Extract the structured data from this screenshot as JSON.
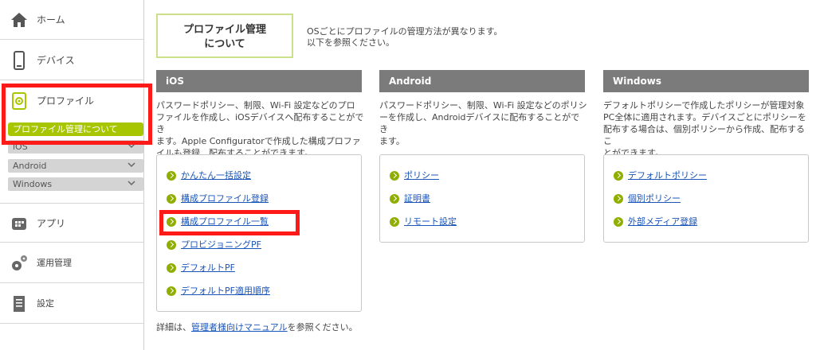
{
  "sidebar": {
    "items": [
      {
        "label": "ホーム",
        "icon": "home-icon"
      },
      {
        "label": "デバイス",
        "icon": "device-icon"
      },
      {
        "label": "プロファイル",
        "icon": "profile-icon"
      },
      {
        "label": "アプリ",
        "icon": "app-icon"
      },
      {
        "label": "運用管理",
        "icon": "gears-icon"
      },
      {
        "label": "設定",
        "icon": "settings-doc-icon"
      }
    ],
    "profile_sub": {
      "active": "プロファイル管理について",
      "items": [
        "iOS",
        "Android",
        "Windows"
      ]
    }
  },
  "main": {
    "about_title_line1": "プロファイル管理",
    "about_title_line2": "について",
    "intro_line1": "OSごとにプロファイルの管理方法が異なります。",
    "intro_line2": "以下を参照ください。",
    "columns": [
      {
        "title": "iOS",
        "desc": [
          "パスワードポリシー、制限、Wi-Fi 設定などのプロ",
          "ファイルを作成し、iOSデバイスへ配布することができ",
          "ます。Apple Configuratorで作成した構成プロファ",
          "イルも登録、配布することができます。"
        ],
        "links": [
          "かんたん一括設定",
          "構成プロファイル登録",
          "構成プロファイル一覧",
          "プロビジョニングPF",
          "デフォルトPF",
          "デフォルトPF適用順序"
        ]
      },
      {
        "title": "Android",
        "desc": [
          "パスワードポリシー、制限、Wi-Fi 設定などのポリシ",
          "ーを作成し、Androidデバイスに配布することができ",
          "ます。"
        ],
        "links": [
          "ポリシー",
          "証明書",
          "リモート設定"
        ]
      },
      {
        "title": "Windows",
        "desc": [
          "デフォルトポリシーで作成したポリシーが管理対象",
          "PC全体に適用されます。デバイスごとにポリシーを",
          "配布する場合は、個別ポリシーから作成、配布するこ",
          "とができます。"
        ],
        "links": [
          "デフォルトポリシー",
          "個別ポリシー",
          "外部メディア登録"
        ]
      }
    ],
    "footer_prefix": "詳細は、",
    "footer_link": "管理者様向けマニュアル",
    "footer_suffix": "を参照ください。"
  },
  "colors": {
    "accent_green": "#a8c600",
    "highlight_red": "#ff1a1a",
    "header_gray": "#7b7b7b",
    "link_blue": "#1a55b8"
  }
}
